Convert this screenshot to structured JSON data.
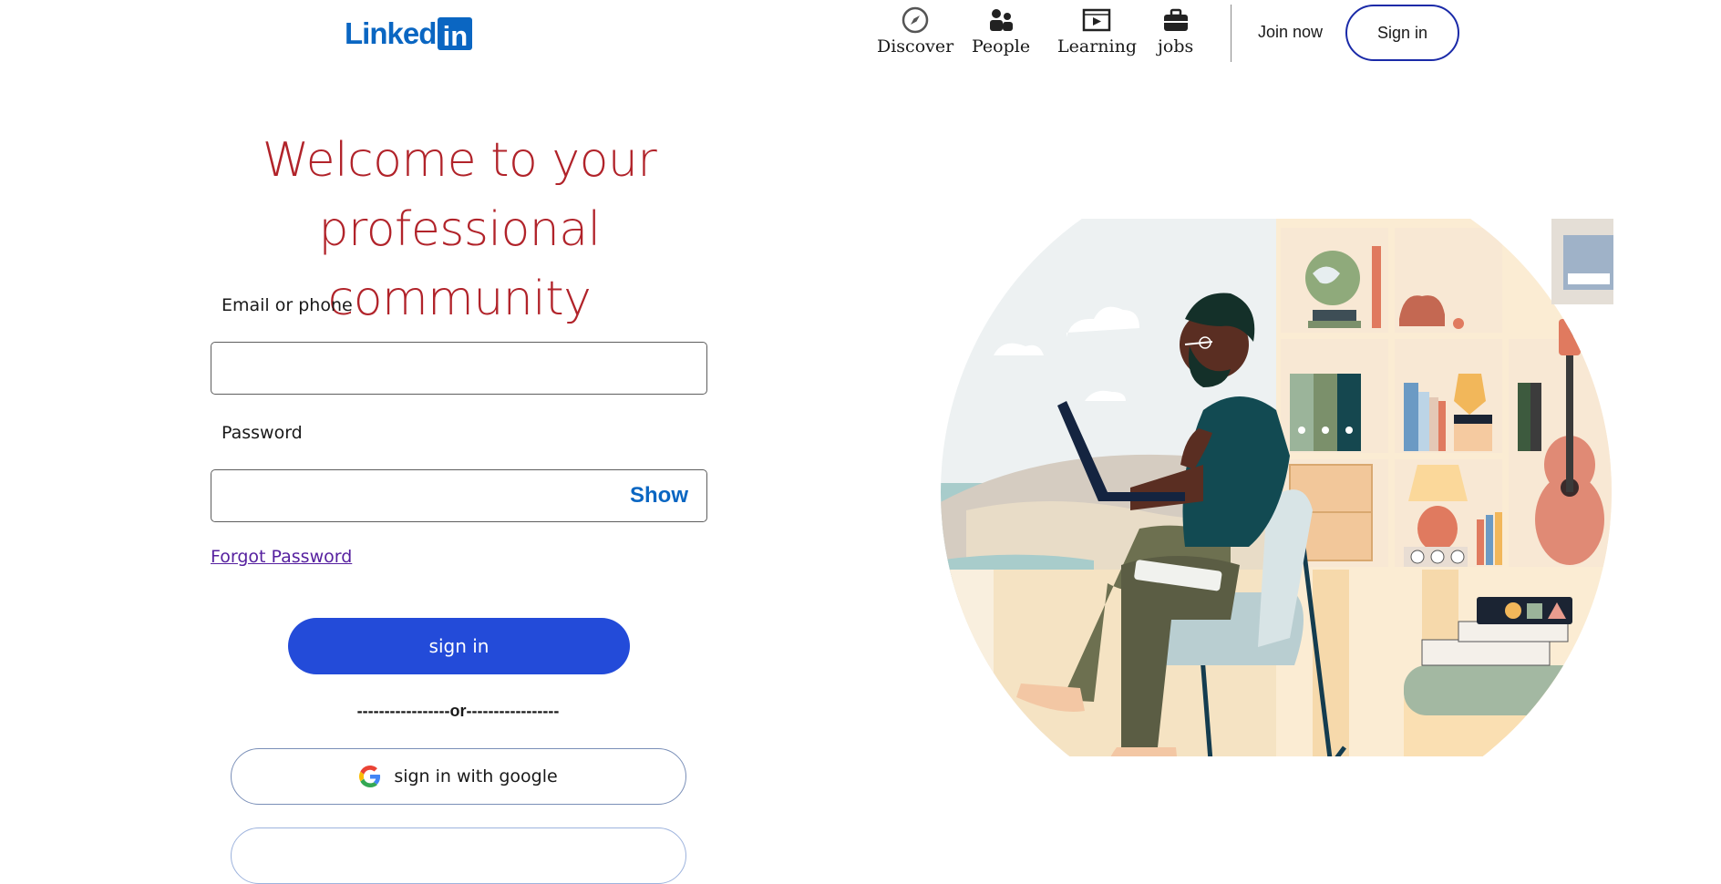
{
  "header": {
    "logo_word": "Linked",
    "logo_box": "in",
    "nav": [
      {
        "label": "Discover",
        "icon": "compass-icon"
      },
      {
        "label": "People",
        "icon": "people-icon"
      },
      {
        "label": "Learning",
        "icon": "video-icon"
      },
      {
        "label": "jobs",
        "icon": "briefcase-icon"
      }
    ],
    "join_label": "Join now",
    "signin_label": "Sign in"
  },
  "main": {
    "headline_line1": "Welcome to your",
    "headline_line2": "professional community",
    "email_label": "Email or phone",
    "email_value": "",
    "password_label": "Password",
    "password_value": "",
    "show_label": "Show",
    "forgot_label": "Forgot Password",
    "signin_label": "sign in",
    "or_separator": "-----------------or-----------------",
    "google_label": "sign in with google"
  },
  "colors": {
    "brand": "#0a66c2",
    "headline": "#b1232a",
    "primary_button": "#234bd9",
    "link_visited": "#56209f"
  }
}
